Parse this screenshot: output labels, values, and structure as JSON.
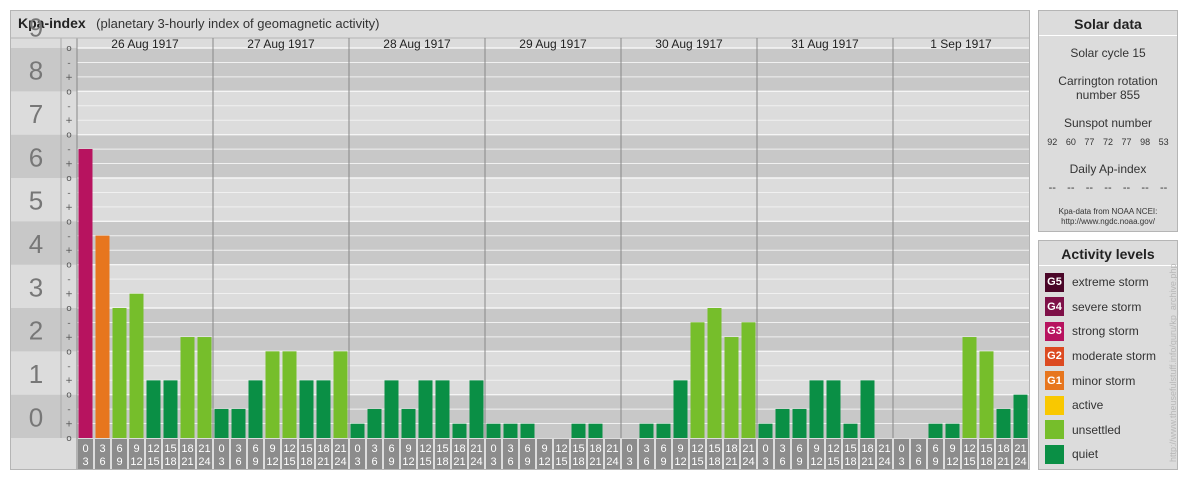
{
  "header": {
    "title": "Kpa-index",
    "subtitle": "(planetary 3-hourly index of geomagnetic activity)"
  },
  "colors": {
    "quiet": "#0a8f45",
    "unsettled": "#76be2b",
    "active": "#f9c800",
    "g1": "#e7761e",
    "g2": "#dc4a21",
    "g3": "#b7135f",
    "g4": "#7e1048",
    "g5": "#4a0628"
  },
  "chart_data": {
    "type": "bar",
    "ylim": [
      0,
      9
    ],
    "y_ticks": [
      "0",
      "1",
      "2",
      "3",
      "4",
      "5",
      "6",
      "7",
      "8",
      "9"
    ],
    "sub_ticks": [
      "o",
      "+",
      "-"
    ],
    "days": [
      "26 Aug 1917",
      "27 Aug 1917",
      "28 Aug 1917",
      "29 Aug 1917",
      "30 Aug 1917",
      "31 Aug 1917",
      "1 Sep 1917"
    ],
    "interval_labels": [
      [
        "0",
        "3"
      ],
      [
        "3",
        "6"
      ],
      [
        "6",
        "9"
      ],
      [
        "9",
        "12"
      ],
      [
        "12",
        "15"
      ],
      [
        "15",
        "18"
      ],
      [
        "18",
        "21"
      ],
      [
        "21",
        "24"
      ]
    ],
    "values": [
      [
        6.67,
        4.67,
        3.0,
        3.33,
        1.33,
        1.33,
        2.33,
        2.33
      ],
      [
        0.67,
        0.67,
        1.33,
        2.0,
        2.0,
        1.33,
        1.33,
        2.0
      ],
      [
        0.33,
        0.67,
        1.33,
        0.67,
        1.33,
        1.33,
        0.33,
        1.33
      ],
      [
        0.33,
        0.33,
        0.33,
        0.0,
        0.0,
        0.33,
        0.33,
        0.0
      ],
      [
        0.0,
        0.33,
        0.33,
        1.33,
        2.67,
        3.0,
        2.33,
        2.67
      ],
      [
        0.33,
        0.67,
        0.67,
        1.33,
        1.33,
        0.33,
        1.33,
        0.0
      ],
      [
        0.0,
        0.0,
        0.33,
        0.33,
        2.33,
        2.0,
        0.67,
        1.0
      ]
    ]
  },
  "solar": {
    "title": "Solar data",
    "cycle": "Solar cycle 15",
    "carrington_line1": "Carrington rotation",
    "carrington_line2": "number 855",
    "sunspot_label": "Sunspot number",
    "sunspot_values": [
      "92",
      "60",
      "77",
      "72",
      "77",
      "98",
      "53"
    ],
    "ap_label": "Daily Ap-index",
    "ap_values": [
      "--",
      "--",
      "--",
      "--",
      "--",
      "--",
      "--"
    ],
    "source_line1": "Kpa-data from NOAA NCEI:",
    "source_line2": "http://www.ngdc.noaa.gov/"
  },
  "levels": {
    "title": "Activity levels",
    "items": [
      {
        "badge": "G5",
        "label": "extreme storm",
        "color": "#4a0628"
      },
      {
        "badge": "G4",
        "label": "severe storm",
        "color": "#7e1048"
      },
      {
        "badge": "G3",
        "label": "strong storm",
        "color": "#b7135f"
      },
      {
        "badge": "G2",
        "label": "moderate storm",
        "color": "#dc4a21"
      },
      {
        "badge": "G1",
        "label": "minor storm",
        "color": "#e7761e"
      },
      {
        "badge": "",
        "label": "active",
        "color": "#f9c800"
      },
      {
        "badge": "",
        "label": "unsettled",
        "color": "#76be2b"
      },
      {
        "badge": "",
        "label": "quiet",
        "color": "#0a8f45"
      }
    ]
  },
  "credit": "http://www.theusefulstuff.info/guru/kp_archive.php"
}
